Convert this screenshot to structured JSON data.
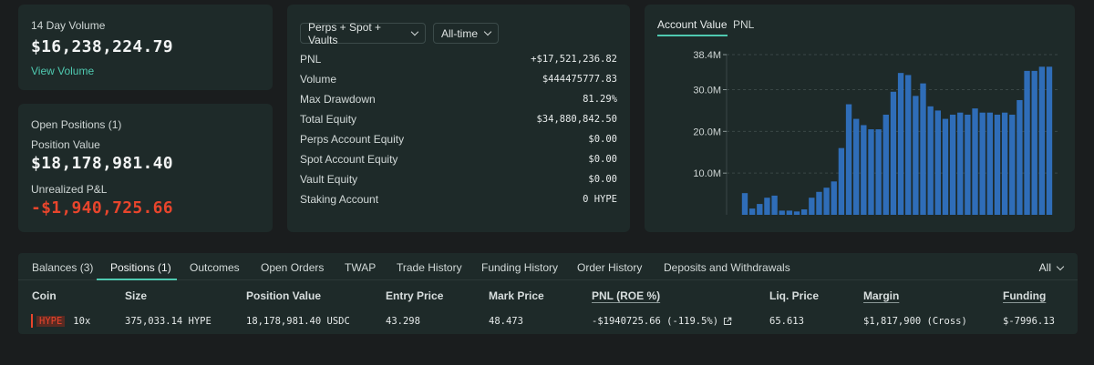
{
  "volume_card": {
    "title": "14 Day Volume",
    "value": "$16,238,224.79",
    "link": "View Volume"
  },
  "positions_card": {
    "title": "Open Positions (1)",
    "position_value_label": "Position Value",
    "position_value": "$18,178,981.40",
    "upnl_label": "Unrealized P&L",
    "upnl_value": "-$1,940,725.66"
  },
  "stats": {
    "filter_label": "Perps + Spot + Vaults",
    "range_label": "All-time",
    "rows": [
      {
        "label": "PNL",
        "value": "+$17,521,236.82"
      },
      {
        "label": "Volume",
        "value": "$444475777.83"
      },
      {
        "label": "Max Drawdown",
        "value": "81.29%"
      },
      {
        "label": "Total Equity",
        "value": "$34,880,842.50"
      },
      {
        "label": "Perps Account Equity",
        "value": "$0.00"
      },
      {
        "label": "Spot Account Equity",
        "value": "$0.00"
      },
      {
        "label": "Vault Equity",
        "value": "$0.00"
      },
      {
        "label": "Staking Account",
        "value": "0 HYPE"
      }
    ]
  },
  "chart": {
    "tabs": [
      "Account Value",
      "PNL"
    ],
    "active_tab": "Account Value",
    "accent_color": "#4fc9b0",
    "bar_color": "#2f6db8"
  },
  "chart_data": {
    "type": "bar",
    "ylim": [
      0,
      38.4
    ],
    "yticks": [
      {
        "value": 38.4,
        "label": "38.4M"
      },
      {
        "value": 30.0,
        "label": "30.0M"
      },
      {
        "value": 20.0,
        "label": "20.0M"
      },
      {
        "value": 10.0,
        "label": "10.0M"
      }
    ],
    "values": [
      5.2,
      1.5,
      2.6,
      4.1,
      4.6,
      1.0,
      1.0,
      0.8,
      1.3,
      4.1,
      5.5,
      6.5,
      8.0,
      16.0,
      26.5,
      23.0,
      21.5,
      20.5,
      20.5,
      24.0,
      29.5,
      34.0,
      33.5,
      28.5,
      31.5,
      26.0,
      25.0,
      23.0,
      24.0,
      24.5,
      24.0,
      25.5,
      24.5,
      24.5,
      24.0,
      24.5,
      24.0,
      27.5,
      34.5,
      34.5,
      35.5,
      35.5
    ]
  },
  "bottom": {
    "tabs": [
      {
        "label": "Balances (3)"
      },
      {
        "label": "Positions (1)"
      },
      {
        "label": "Outcomes"
      },
      {
        "label": "Open Orders"
      },
      {
        "label": "TWAP"
      },
      {
        "label": "Trade History"
      },
      {
        "label": "Funding History"
      },
      {
        "label": "Order History"
      },
      {
        "label": "Deposits and Withdrawals"
      }
    ],
    "active_tab": "Positions (1)",
    "filter": "All",
    "columns": [
      "Coin",
      "Size",
      "Position Value",
      "Entry Price",
      "Mark Price",
      "PNL (ROE %)",
      "Liq. Price",
      "Margin",
      "Funding"
    ],
    "row": {
      "coin": "HYPE",
      "leverage": "10x",
      "size": "375,033.14 HYPE",
      "position_value": "18,178,981.40 USDC",
      "entry_price": "43.298",
      "mark_price": "48.473",
      "pnl": "-$1940725.66 (-119.5%)",
      "liq_price": "65.613",
      "margin": "$1,817,900 (Cross)",
      "funding": "$-7996.13"
    }
  }
}
